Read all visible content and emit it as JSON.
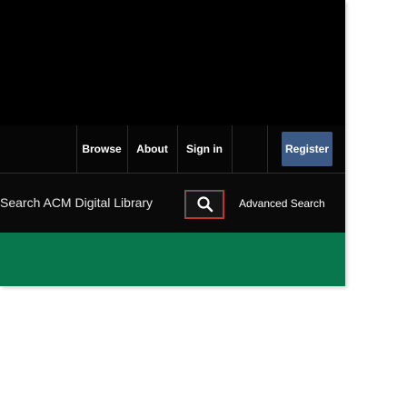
{
  "nav": {
    "items": [
      {
        "label": "Browse"
      },
      {
        "label": "About"
      },
      {
        "label": "Sign in"
      }
    ],
    "register_label": "Register"
  },
  "search": {
    "input_value": "Search ACM Digital Library",
    "advanced_label": "Advanced Search"
  },
  "colors": {
    "header_background": "#000000",
    "register_button": "#3c5a86",
    "search_button_border": "#c0392b",
    "green_band": "#09774e"
  },
  "icons": {
    "search_button": "search-icon"
  }
}
